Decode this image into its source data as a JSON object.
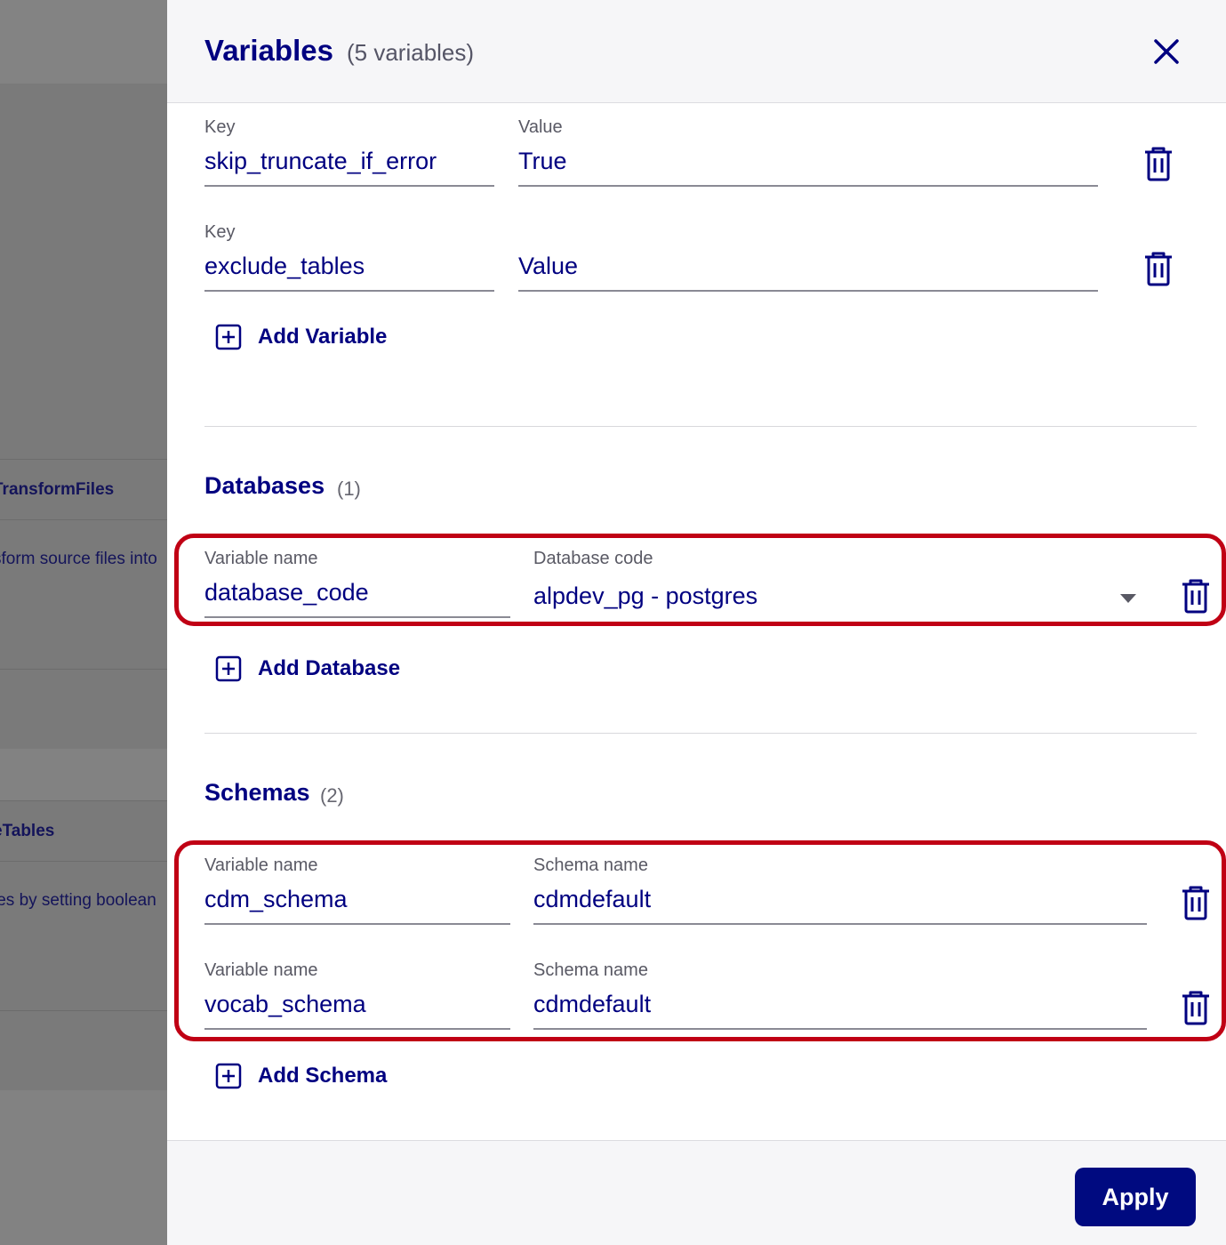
{
  "background": {
    "fragments": [
      "TransformFiles",
      "sform source files into",
      "eTables",
      "les by setting boolean"
    ]
  },
  "drawer": {
    "title": "Variables",
    "subtitle": "(5 variables)"
  },
  "variables": {
    "key_label": "Key",
    "value_label": "Value",
    "rows": [
      {
        "key": "skip_truncate_if_error",
        "value": "True"
      },
      {
        "key": "exclude_tables",
        "value": "Value"
      }
    ],
    "add_label": "Add Variable"
  },
  "databases": {
    "title": "Databases",
    "count": "(1)",
    "name_label": "Variable name",
    "code_label": "Database code",
    "rows": [
      {
        "name": "database_code",
        "code": "alpdev_pg - postgres"
      }
    ],
    "add_label": "Add Database"
  },
  "schemas": {
    "title": "Schemas",
    "count": "(2)",
    "name_label": "Variable name",
    "schema_label": "Schema name",
    "rows": [
      {
        "name": "cdm_schema",
        "schema": "cdmdefault"
      },
      {
        "name": "vocab_schema",
        "schema": "cdmdefault"
      }
    ],
    "add_label": "Add Schema"
  },
  "footer": {
    "apply_label": "Apply"
  },
  "colors": {
    "primary": "#000080",
    "highlight": "#c00014",
    "apply_bg": "#000a80"
  }
}
